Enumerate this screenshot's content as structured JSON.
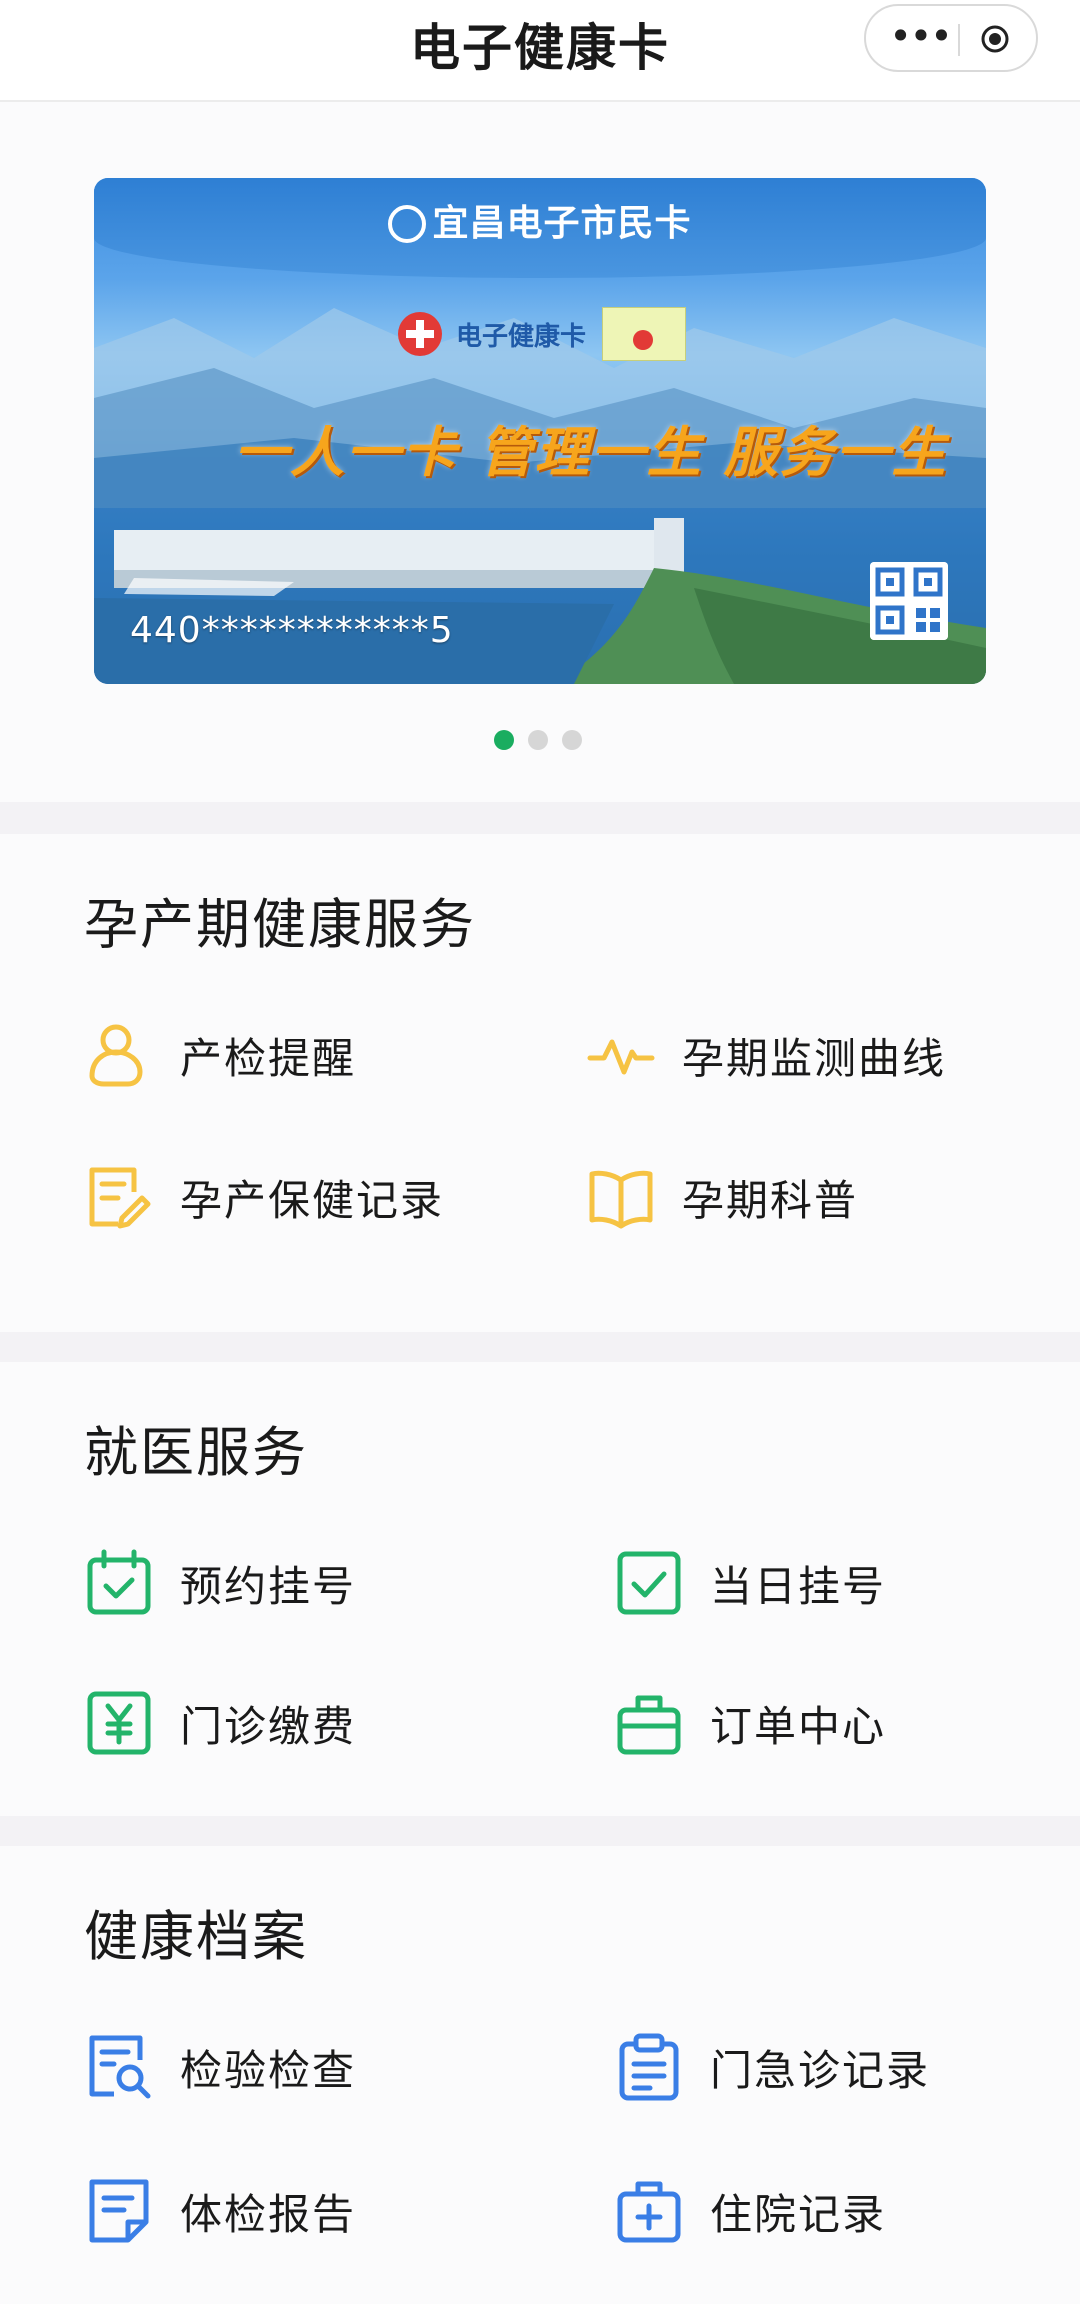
{
  "navbar": {
    "title": "电子健康卡",
    "more_icon": "more-dots-icon",
    "close_icon": "target-close-icon"
  },
  "card": {
    "brand": "宜昌电子市民卡",
    "health_label": "电子健康卡",
    "slogan": "一人一卡 管理一生 服务一生",
    "number": "440************5",
    "qr_icon": "qr-code-icon",
    "carousel_total": 3,
    "carousel_active": 1
  },
  "colors": {
    "accent_green": "#1aad60",
    "maternity_yellow": "#f6c343",
    "clinic_green": "#23b46a",
    "records_blue": "#3a7ee6"
  },
  "sections": {
    "maternity": {
      "title": "孕产期健康服务",
      "items": [
        {
          "label": "产检提醒",
          "icon": "person-icon"
        },
        {
          "label": "孕期监测曲线",
          "icon": "pulse-icon"
        },
        {
          "label": "孕产保健记录",
          "icon": "edit-note-icon"
        },
        {
          "label": "孕期科普",
          "icon": "open-book-icon"
        }
      ]
    },
    "clinic": {
      "title": "就医服务",
      "items": [
        {
          "label": "预约挂号",
          "icon": "calendar-check-icon"
        },
        {
          "label": "当日挂号",
          "icon": "checkbox-icon"
        },
        {
          "label": "门诊缴费",
          "icon": "yuan-icon"
        },
        {
          "label": "订单中心",
          "icon": "bag-icon"
        }
      ]
    },
    "records": {
      "title": "健康档案",
      "items": [
        {
          "label": "检验检查",
          "icon": "search-document-icon"
        },
        {
          "label": "门急诊记录",
          "icon": "clipboard-icon"
        },
        {
          "label": "体检报告",
          "icon": "report-icon"
        },
        {
          "label": "住院记录",
          "icon": "medical-kit-icon"
        }
      ]
    }
  }
}
